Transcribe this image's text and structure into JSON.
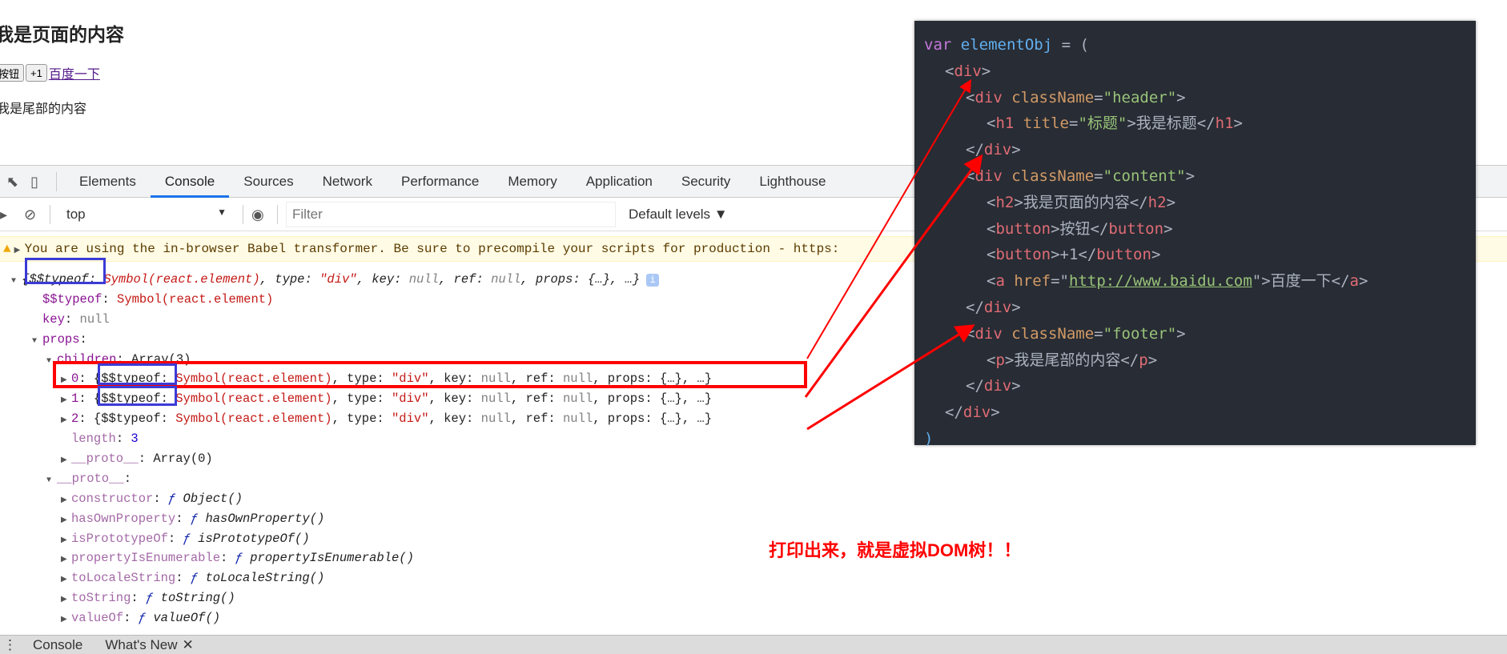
{
  "page": {
    "heading": "我是页面的内容",
    "button1": "按钮",
    "button2": "+1",
    "link": "百度一下",
    "footer": "我是尾部的内容"
  },
  "devtools": {
    "tabs": [
      "Elements",
      "Console",
      "Sources",
      "Network",
      "Performance",
      "Memory",
      "Application",
      "Security",
      "Lighthouse"
    ],
    "active_tab": "Console",
    "context": "top",
    "filter_placeholder": "Filter",
    "levels": "Default levels ▼",
    "warning": "You are using the in-browser Babel transformer. Be sure to precompile your scripts for production - https:",
    "bottom_tabs": [
      "Console",
      "What's New"
    ],
    "tree": [
      {
        "depth": 0,
        "arrow": "▼",
        "info": true,
        "segs": [
          [
            "{$$typeof: ",
            "fi"
          ],
          [
            "Symbol(react.element)",
            "s it"
          ],
          [
            ", type: ",
            "fi"
          ],
          [
            "\"div\"",
            "s it"
          ],
          [
            ", key: ",
            "fi"
          ],
          [
            "null",
            "n it"
          ],
          [
            ", ref: ",
            "fi"
          ],
          [
            "null",
            "n it"
          ],
          [
            ", props: {…}, …}",
            "fi"
          ]
        ]
      },
      {
        "depth": 1,
        "arrow": "",
        "segs": [
          [
            "$$typeof",
            "k"
          ],
          [
            ": ",
            "p"
          ],
          [
            "Symbol(react.element)",
            "s"
          ]
        ]
      },
      {
        "depth": 1,
        "arrow": "",
        "segs": [
          [
            "key",
            "k"
          ],
          [
            ": ",
            "p"
          ],
          [
            "null",
            "n"
          ]
        ]
      },
      {
        "depth": 1,
        "arrow": "▼",
        "segs": [
          [
            "props",
            "k"
          ],
          [
            ":",
            "p"
          ]
        ]
      },
      {
        "depth": 2,
        "arrow": "▼",
        "segs": [
          [
            "children",
            "k"
          ],
          [
            ": Array(3)",
            "p"
          ]
        ]
      },
      {
        "depth": 3,
        "arrow": "▶",
        "segs": [
          [
            "0",
            "k"
          ],
          [
            ": {$$typeof: ",
            "p"
          ],
          [
            "Symbol(react.element)",
            "s"
          ],
          [
            ", type: ",
            "p"
          ],
          [
            "\"div\"",
            "s"
          ],
          [
            ", key: ",
            "p"
          ],
          [
            "null",
            "n"
          ],
          [
            ", ref: ",
            "p"
          ],
          [
            "null",
            "n"
          ],
          [
            ", props: {…}, …}",
            "p"
          ]
        ]
      },
      {
        "depth": 3,
        "arrow": "▶",
        "segs": [
          [
            "1",
            "k"
          ],
          [
            ": {$$typeof: ",
            "p"
          ],
          [
            "Symbol(react.element)",
            "s"
          ],
          [
            ", type: ",
            "p"
          ],
          [
            "\"div\"",
            "s"
          ],
          [
            ", key: ",
            "p"
          ],
          [
            "null",
            "n"
          ],
          [
            ", ref: ",
            "p"
          ],
          [
            "null",
            "n"
          ],
          [
            ", props: {…}, …}",
            "p"
          ]
        ]
      },
      {
        "depth": 3,
        "arrow": "▶",
        "segs": [
          [
            "2",
            "k"
          ],
          [
            ": {$$typeof: ",
            "p"
          ],
          [
            "Symbol(react.element)",
            "s"
          ],
          [
            ", type: ",
            "p"
          ],
          [
            "\"div\"",
            "s"
          ],
          [
            ", key: ",
            "p"
          ],
          [
            "null",
            "n"
          ],
          [
            ", ref: ",
            "p"
          ],
          [
            "null",
            "n"
          ],
          [
            ", props: {…}, …}",
            "p"
          ]
        ]
      },
      {
        "depth": 3,
        "arrow": "",
        "segs": [
          [
            "length",
            "kd"
          ],
          [
            ": ",
            "p"
          ],
          [
            "3",
            "num"
          ]
        ]
      },
      {
        "depth": 3,
        "arrow": "▶",
        "segs": [
          [
            "__proto__",
            "kd"
          ],
          [
            ": Array(0)",
            "p"
          ]
        ]
      },
      {
        "depth": 2,
        "arrow": "▼",
        "segs": [
          [
            "__proto__",
            "kd"
          ],
          [
            ":",
            "p"
          ]
        ]
      },
      {
        "depth": 3,
        "arrow": "▶",
        "segs": [
          [
            "constructor",
            "kd"
          ],
          [
            ": ",
            "p"
          ],
          [
            "ƒ ",
            "f"
          ],
          [
            "Object()",
            "fi"
          ]
        ]
      },
      {
        "depth": 3,
        "arrow": "▶",
        "segs": [
          [
            "hasOwnProperty",
            "kd"
          ],
          [
            ": ",
            "p"
          ],
          [
            "ƒ ",
            "f"
          ],
          [
            "hasOwnProperty()",
            "fi"
          ]
        ]
      },
      {
        "depth": 3,
        "arrow": "▶",
        "segs": [
          [
            "isPrototypeOf",
            "kd"
          ],
          [
            ": ",
            "p"
          ],
          [
            "ƒ ",
            "f"
          ],
          [
            "isPrototypeOf()",
            "fi"
          ]
        ]
      },
      {
        "depth": 3,
        "arrow": "▶",
        "segs": [
          [
            "propertyIsEnumerable",
            "kd"
          ],
          [
            ": ",
            "p"
          ],
          [
            "ƒ ",
            "f"
          ],
          [
            "propertyIsEnumerable()",
            "fi"
          ]
        ]
      },
      {
        "depth": 3,
        "arrow": "▶",
        "segs": [
          [
            "toLocaleString",
            "kd"
          ],
          [
            ": ",
            "p"
          ],
          [
            "ƒ ",
            "f"
          ],
          [
            "toLocaleString()",
            "fi"
          ]
        ]
      },
      {
        "depth": 3,
        "arrow": "▶",
        "segs": [
          [
            "toString",
            "kd"
          ],
          [
            ": ",
            "p"
          ],
          [
            "ƒ ",
            "f"
          ],
          [
            "toString()",
            "fi"
          ]
        ]
      },
      {
        "depth": 3,
        "arrow": "▶",
        "segs": [
          [
            "valueOf",
            "kd"
          ],
          [
            ": ",
            "p"
          ],
          [
            "ƒ ",
            "f"
          ],
          [
            "valueOf()",
            "fi"
          ]
        ]
      }
    ]
  },
  "code": [
    {
      "depth": 0,
      "segs": [
        [
          "var ",
          "cv"
        ],
        [
          "elementObj ",
          "cn"
        ],
        [
          "= (",
          "co"
        ]
      ]
    },
    {
      "depth": 1,
      "segs": [
        [
          "<",
          "co"
        ],
        [
          "div",
          "ct"
        ],
        [
          ">",
          "co"
        ]
      ]
    },
    {
      "depth": 2,
      "segs": [
        [
          "<",
          "co"
        ],
        [
          "div ",
          "ct"
        ],
        [
          "className",
          "ca"
        ],
        [
          "=",
          "co"
        ],
        [
          "\"header\"",
          "cs"
        ],
        [
          ">",
          "co"
        ]
      ]
    },
    {
      "depth": 3,
      "segs": [
        [
          "<",
          "co"
        ],
        [
          "h1 ",
          "ct"
        ],
        [
          "title",
          "ca"
        ],
        [
          "=",
          "co"
        ],
        [
          "\"标题\"",
          "cs"
        ],
        [
          ">我是标题</",
          "co"
        ],
        [
          "h1",
          "ct"
        ],
        [
          ">",
          "co"
        ]
      ]
    },
    {
      "depth": 2,
      "segs": [
        [
          "</",
          "co"
        ],
        [
          "div",
          "ct"
        ],
        [
          ">",
          "co"
        ]
      ]
    },
    {
      "depth": 2,
      "segs": [
        [
          "<",
          "co"
        ],
        [
          "div ",
          "ct"
        ],
        [
          "className",
          "ca"
        ],
        [
          "=",
          "co"
        ],
        [
          "\"content\"",
          "cs"
        ],
        [
          ">",
          "co"
        ]
      ]
    },
    {
      "depth": 3,
      "segs": [
        [
          "<",
          "co"
        ],
        [
          "h2",
          "ct"
        ],
        [
          ">我是页面的内容</",
          "co"
        ],
        [
          "h2",
          "ct"
        ],
        [
          ">",
          "co"
        ]
      ]
    },
    {
      "depth": 3,
      "segs": [
        [
          "<",
          "co"
        ],
        [
          "button",
          "ct"
        ],
        [
          ">按钮</",
          "co"
        ],
        [
          "button",
          "ct"
        ],
        [
          ">",
          "co"
        ]
      ]
    },
    {
      "depth": 3,
      "segs": [
        [
          "<",
          "co"
        ],
        [
          "button",
          "ct"
        ],
        [
          ">+1</",
          "co"
        ],
        [
          "button",
          "ct"
        ],
        [
          ">",
          "co"
        ]
      ]
    },
    {
      "depth": 3,
      "segs": [
        [
          "<",
          "co"
        ],
        [
          "a ",
          "ct"
        ],
        [
          "href",
          "ca"
        ],
        [
          "=\"",
          "co"
        ],
        [
          "http://www.baidu.com",
          "cu"
        ],
        [
          "\">百度一下</",
          "co"
        ],
        [
          "a",
          "ct"
        ],
        [
          ">",
          "co"
        ]
      ]
    },
    {
      "depth": 2,
      "segs": [
        [
          "</",
          "co"
        ],
        [
          "div",
          "ct"
        ],
        [
          ">",
          "co"
        ]
      ]
    },
    {
      "depth": 2,
      "segs": [
        [
          "<",
          "co"
        ],
        [
          "div ",
          "ct"
        ],
        [
          "className",
          "ca"
        ],
        [
          "=",
          "co"
        ],
        [
          "\"footer\"",
          "cs"
        ],
        [
          ">",
          "co"
        ]
      ]
    },
    {
      "depth": 3,
      "segs": [
        [
          "<",
          "co"
        ],
        [
          "p",
          "ct"
        ],
        [
          ">我是尾部的内容</",
          "co"
        ],
        [
          "p",
          "ct"
        ],
        [
          ">",
          "co"
        ]
      ]
    },
    {
      "depth": 2,
      "segs": [
        [
          "</",
          "co"
        ],
        [
          "div",
          "ct"
        ],
        [
          ">",
          "co"
        ]
      ]
    },
    {
      "depth": 1,
      "segs": [
        [
          "</",
          "co"
        ],
        [
          "div",
          "ct"
        ],
        [
          ">",
          "co"
        ]
      ]
    },
    {
      "depth": 0,
      "segs": [
        [
          ")",
          "cn"
        ]
      ]
    }
  ],
  "annotation": "打印出来，就是虚拟DOM树！！",
  "colors": {
    "highlight_red": "#ff0000",
    "highlight_blue": "#3b3bd6",
    "code_bg": "#282c34",
    "warning_bg": "#fffbe5"
  }
}
